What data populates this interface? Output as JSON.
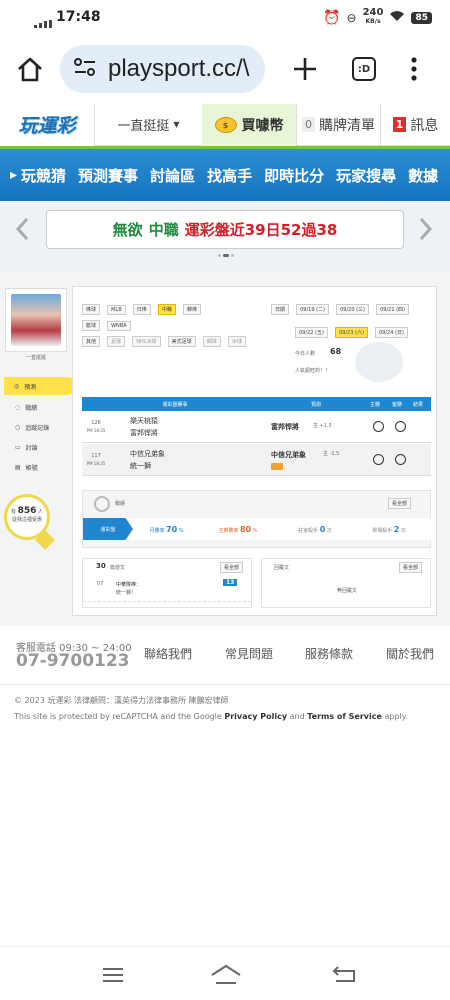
{
  "status": {
    "time": "17:48",
    "net_speed": "240",
    "net_unit": "KB/s",
    "battery": "85"
  },
  "browser": {
    "url": "playsport.cc/\\",
    "tab_label": ":D"
  },
  "site": {
    "logo": "玩運彩",
    "menu_label": "一直挺挺",
    "buy_label": "買噱幣",
    "cart_count": "0",
    "cart_label": "購牌清單",
    "msg_count": "1",
    "msg_label": "訊息"
  },
  "nav": [
    "玩競猜",
    "預測賽事",
    "討論區",
    "找高手",
    "即時比分",
    "玩家搜尋",
    "數據"
  ],
  "banner": {
    "prefix": "無欲",
    "league": "中職",
    "text": "運彩盤近39日52過38"
  },
  "sidebar": {
    "username": "一直挺挺",
    "items": [
      "預測",
      "戰績",
      "追蹤記錄",
      "討論",
      "帳號"
    ],
    "helped_prefix": "有",
    "helped_count": "856",
    "helped_suffix": "人",
    "helped_note": "從我這裡受惠"
  },
  "filters": {
    "league_label": "棒球",
    "leagues": [
      "MLB",
      "日棒",
      "中職",
      "韓棒"
    ],
    "bball_label": "籃球",
    "bball": [
      "WNBA"
    ],
    "other_label": "其他",
    "others": [
      "足球",
      "NHL冰球",
      "美式足球",
      "網球",
      "冰球"
    ],
    "date_label": "日期",
    "dates": [
      "09/19 (二)",
      "09/20 (三)",
      "09/21 (四)",
      "09/22 (五)",
      "09/23 (六)",
      "09/24 (日)"
    ]
  },
  "today": {
    "label": "今日人數",
    "count": "68",
    "note": "人氣超旺的！！"
  },
  "table": {
    "headers": [
      "運彩盤賽事",
      "預測",
      "主勝",
      "客勝",
      "結果"
    ],
    "rows": [
      {
        "no": "126",
        "time": "PM 18:35",
        "home": "樂天桃猿",
        "away": "富邦悍將",
        "pick": "富邦悍將",
        "spread": "主 +1.5"
      },
      {
        "no": "117",
        "time": "PM 18:35",
        "home": "中信兄弟象",
        "away": "統一獅",
        "pick": "中信兄弟象",
        "spread": "主 -1.5"
      }
    ]
  },
  "record": {
    "title": "戰績",
    "more": "看全部",
    "tab": "運彩盤",
    "stats": [
      {
        "label": "月勝率",
        "value": "70",
        "unit": "%"
      },
      {
        "label": "主推勝率",
        "value": "80",
        "unit": "%"
      },
      {
        "label": "莊家殺手",
        "value": "0",
        "unit": "次"
      },
      {
        "label": "單場殺手",
        "value": "2",
        "unit": "次"
      }
    ]
  },
  "posts": {
    "count": "30",
    "label": "篇發文",
    "more": "看全部",
    "date": "07",
    "title": "中華隊棒：",
    "sub": "統一獅！",
    "tag": "13"
  },
  "replies": {
    "label": "回覆文",
    "more": "看全部",
    "empty": "無回覆文"
  },
  "footer": {
    "phone_label": "客服電話 09:30 ~ 24:00",
    "phone": "07-9700123",
    "links": [
      "聯絡我們",
      "常見問題",
      "服務條款",
      "關於我們"
    ],
    "copyright": "© 2023 玩運彩 法律顧問：漢英得力法律事務所 陳鵬宏律師",
    "recaptcha_pre": "This site is protected by reCAPTCHA and the Google",
    "privacy": "Privacy Policy",
    "and": "and",
    "terms": "Terms of Service",
    "apply": "apply."
  },
  "colors": {
    "accent_blue": "#1f86d0",
    "green": "#7cc242",
    "yellow": "#ffe24a",
    "red": "#e02d2d"
  }
}
